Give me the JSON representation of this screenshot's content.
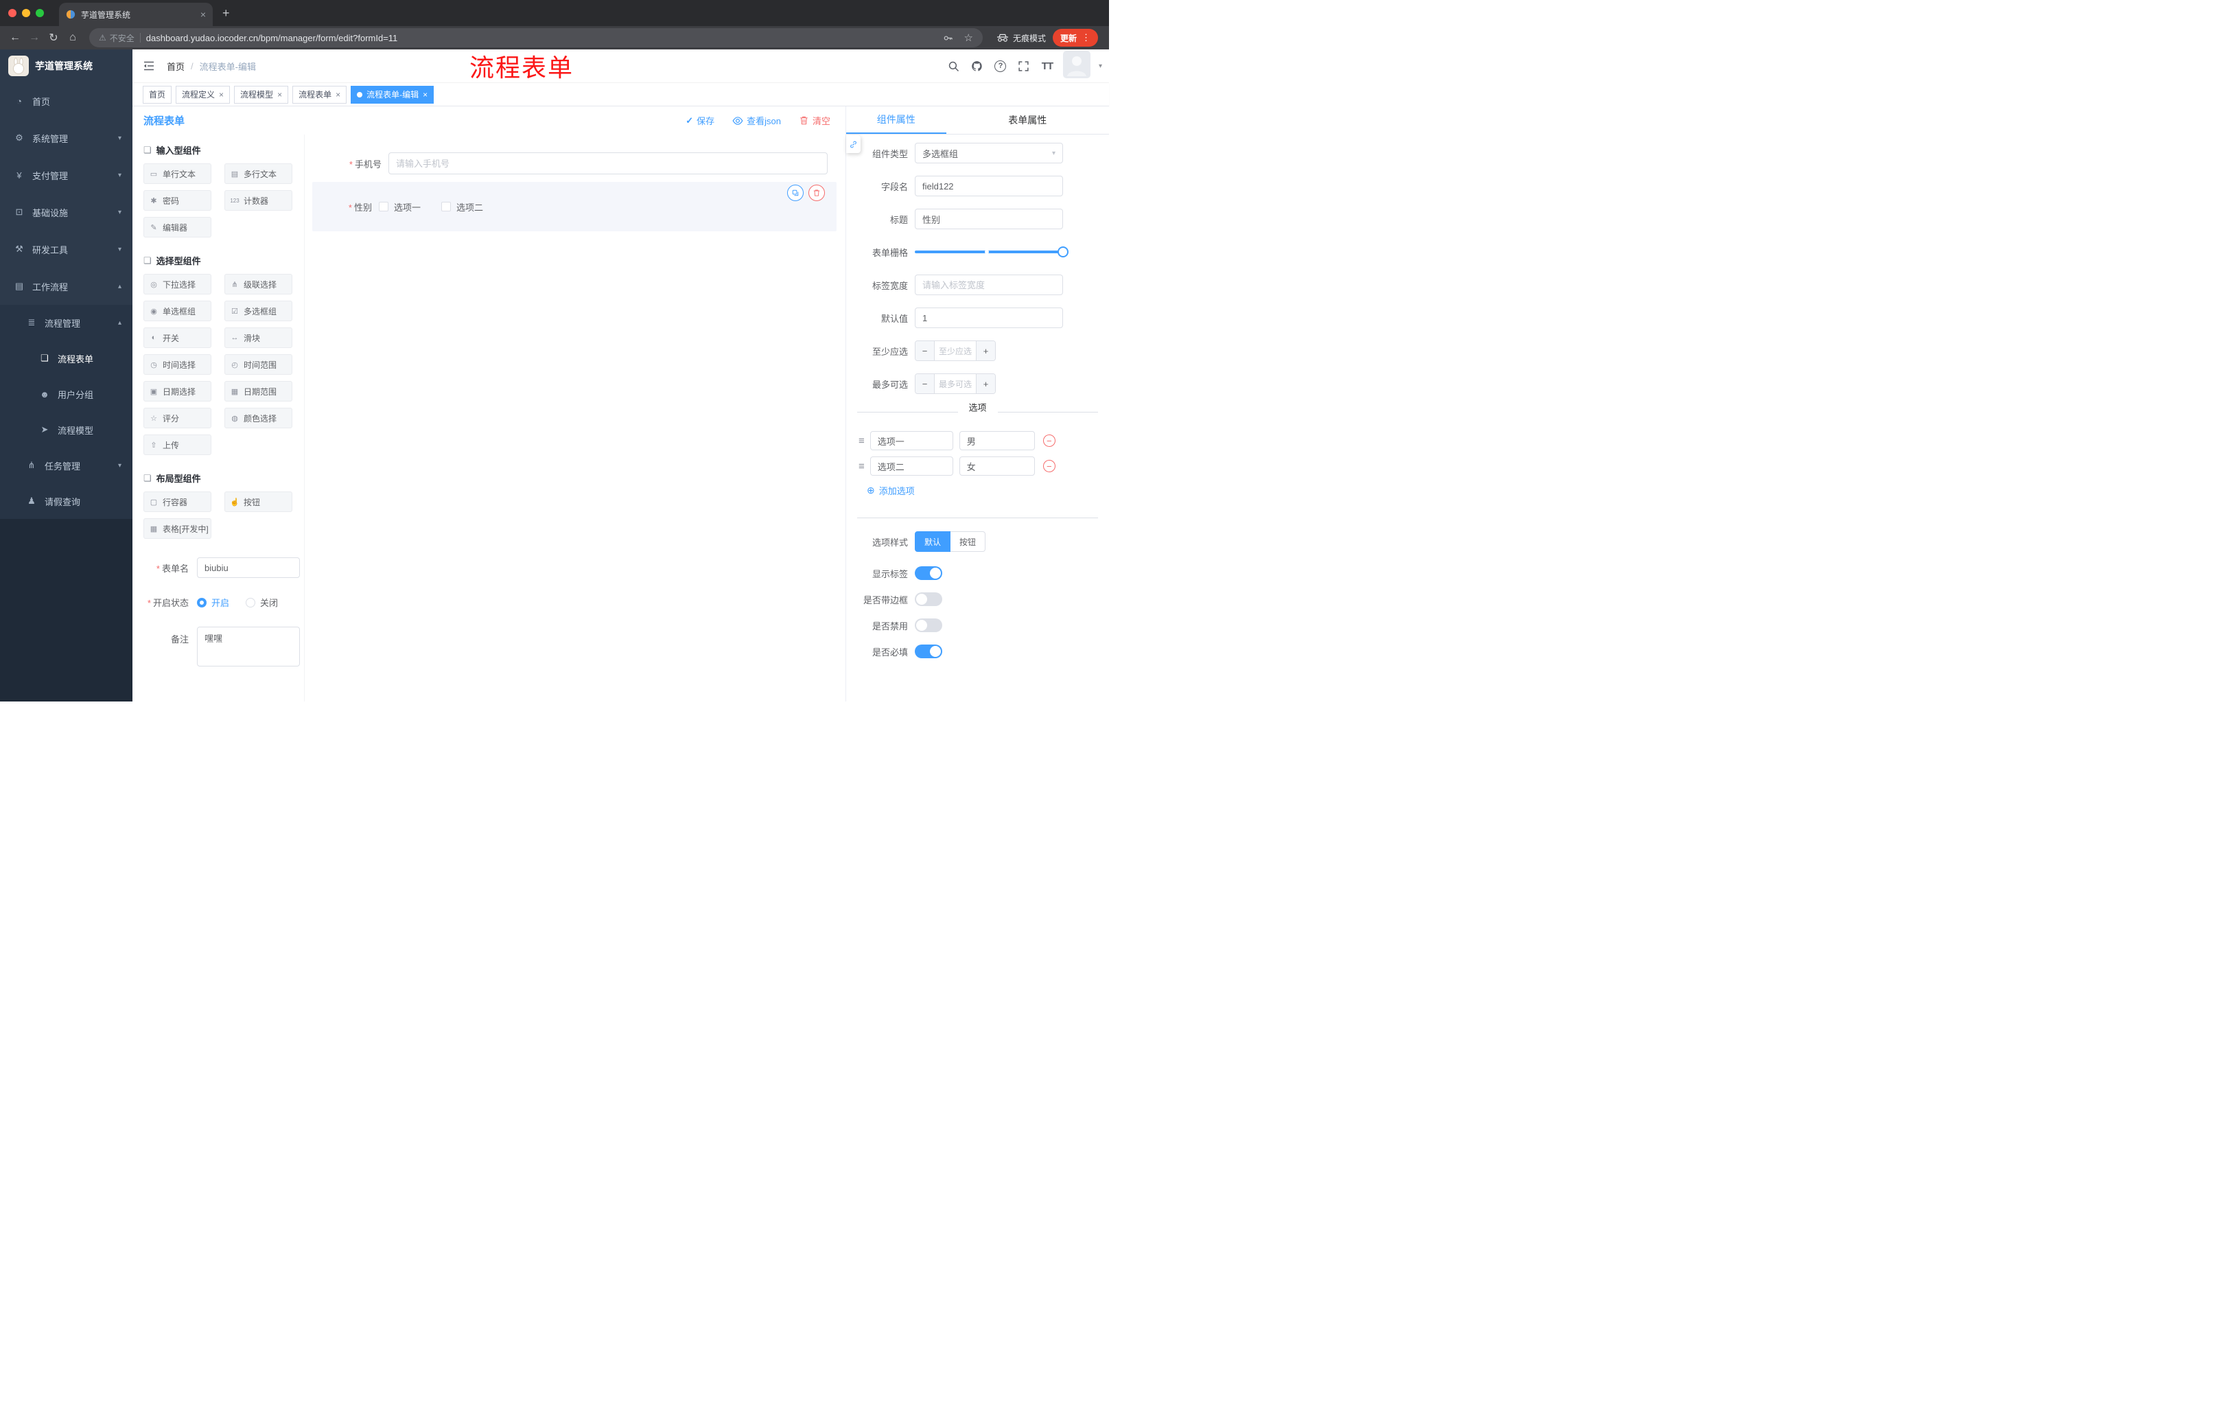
{
  "icons": {
    "caret_down": "▾",
    "caret_up": "▴",
    "close": "×",
    "plus": "+",
    "back": "←",
    "forward": "→",
    "reload": "↻",
    "home": "⌂",
    "warning": "⚠",
    "star": "☆",
    "kebab": "⋮",
    "check": "✓",
    "add_circle": "⊕",
    "remove": "−",
    "handle": "≡"
  },
  "browser": {
    "tab_title": "芋道管理系统",
    "security": "不安全",
    "url": "dashboard.yudao.iocoder.cn/bpm/manager/form/edit?formId=11",
    "incognito": "无痕模式",
    "update": "更新"
  },
  "header": {
    "breadcrumb_home": "首页",
    "breadcrumb_sep": "/",
    "breadcrumb_current": "流程表单-编辑",
    "annotation": "流程表单",
    "help_icon": "?",
    "text_size_icon": "TT"
  },
  "sidebar": {
    "logo_title": "芋道管理系统",
    "menu": [
      {
        "icon": "◔",
        "label": "首页"
      },
      {
        "icon": "⚙",
        "label": "系统管理"
      },
      {
        "icon": "¥",
        "label": "支付管理"
      },
      {
        "icon": "⊡",
        "label": "基础设施"
      },
      {
        "icon": "⚒",
        "label": "研发工具"
      },
      {
        "icon": "▤",
        "label": "工作流程"
      },
      {
        "icon": "≣",
        "label": "流程管理"
      },
      {
        "icon": "❏",
        "label": "流程表单"
      },
      {
        "icon": "☻",
        "label": "用户分组"
      },
      {
        "icon": "➤",
        "label": "流程模型"
      },
      {
        "icon": "⋔",
        "label": "任务管理"
      },
      {
        "icon": "♟",
        "label": "请假查询"
      }
    ]
  },
  "tags": [
    {
      "label": "首页"
    },
    {
      "label": "流程定义"
    },
    {
      "label": "流程模型"
    },
    {
      "label": "流程表单"
    },
    {
      "label": "流程表单-编辑"
    }
  ],
  "designer": {
    "required_mark": "*",
    "toolbar": {
      "title": "流程表单",
      "save": "保存",
      "view_json": "查看json",
      "clear": "清空"
    },
    "palette": [
      {
        "title": "输入型组件",
        "items": [
          {
            "icon": "▭",
            "label": "单行文本"
          },
          {
            "icon": "▤",
            "label": "多行文本"
          },
          {
            "icon": "✱",
            "label": "密码"
          },
          {
            "icon": "123",
            "label": "计数器"
          },
          {
            "icon": "✎",
            "label": "编辑器"
          }
        ]
      },
      {
        "title": "选择型组件",
        "items": [
          {
            "icon": "◎",
            "label": "下拉选择"
          },
          {
            "icon": "⋔",
            "label": "级联选择"
          },
          {
            "icon": "◉",
            "label": "单选框组"
          },
          {
            "icon": "☑",
            "label": "多选框组"
          },
          {
            "icon": "◐",
            "label": "开关"
          },
          {
            "icon": "↔",
            "label": "滑块"
          },
          {
            "icon": "◷",
            "label": "时间选择"
          },
          {
            "icon": "◴",
            "label": "时间范围"
          },
          {
            "icon": "▣",
            "label": "日期选择"
          },
          {
            "icon": "▦",
            "label": "日期范围"
          },
          {
            "icon": "☆",
            "label": "评分"
          },
          {
            "icon": "◍",
            "label": "颜色选择"
          },
          {
            "icon": "⇧",
            "label": "上传"
          }
        ]
      },
      {
        "title": "布局型组件",
        "items": [
          {
            "icon": "▢",
            "label": "行容器"
          },
          {
            "icon": "☝",
            "label": "按钮"
          },
          {
            "icon": "▦",
            "label": "表格[开发中]"
          }
        ]
      }
    ],
    "form": {
      "name_label": "表单名",
      "name_value": "biubiu",
      "status_label": "开启状态",
      "status_on": "开启",
      "status_off": "关闭",
      "remark_label": "备注",
      "remark_value": "嘿嘿"
    },
    "canvas": {
      "phone_label": "手机号",
      "phone_placeholder": "请输入手机号",
      "gender_label": "性别",
      "gender_option1": "选项一",
      "gender_option2": "选项二"
    },
    "props": {
      "tab_component": "组件属性",
      "tab_form": "表单属性",
      "type_label": "组件类型",
      "type_value": "多选框组",
      "field_label": "字段名",
      "field_value": "field122",
      "title_label": "标题",
      "title_value": "性别",
      "grid_label": "表单栅格",
      "width_label": "标签宽度",
      "width_placeholder": "请输入标签宽度",
      "default_label": "默认值",
      "default_value": "1",
      "min_label": "至少应选",
      "min_placeholder": "至少应选",
      "max_label": "最多可选",
      "max_placeholder": "最多可选",
      "options_title": "选项",
      "options": [
        {
          "name": "选项一",
          "value": "男"
        },
        {
          "name": "选项二",
          "value": "女"
        }
      ],
      "add_option": "添加选项",
      "style_label": "选项样式",
      "style_default": "默认",
      "style_button": "按钮",
      "switches": [
        {
          "label": "显示标签",
          "state": "on"
        },
        {
          "label": "是否带边框",
          "state": "off"
        },
        {
          "label": "是否禁用",
          "state": "off"
        },
        {
          "label": "是否必填",
          "state": "on"
        }
      ]
    }
  }
}
